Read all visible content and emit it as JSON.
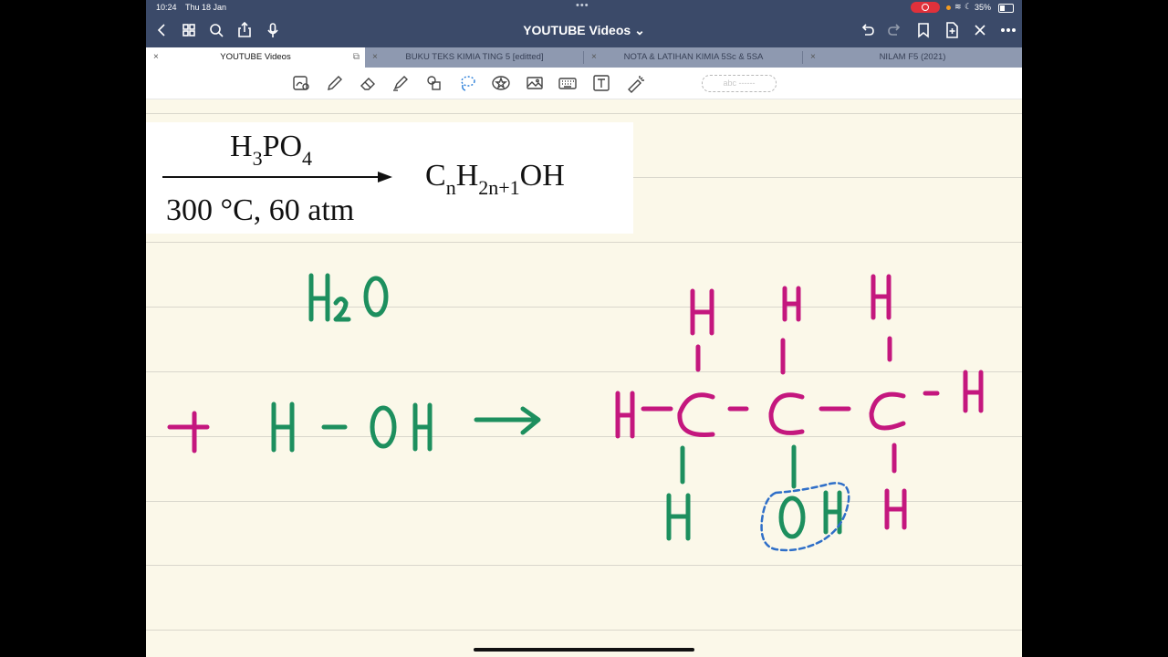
{
  "status_bar": {
    "time": "10:24",
    "date": "Thu 18 Jan",
    "battery": "35%"
  },
  "app": {
    "title": "YOUTUBE Videos"
  },
  "icons": {
    "back": "chevron-left-icon",
    "grid": "grid-icon",
    "search": "search-icon",
    "share": "share-icon",
    "mic": "microphone-icon",
    "undo": "undo-icon",
    "redo": "redo-icon",
    "bookmark": "bookmark-icon",
    "add_page": "add-page-icon",
    "close": "close-icon",
    "more": "more-icon"
  },
  "tabs": [
    {
      "label": "YOUTUBE Videos",
      "active": true
    },
    {
      "label": "BUKU TEKS KIMIA TING 5 [editted]",
      "active": false
    },
    {
      "label": "NOTA & LATIHAN KIMIA 5Sc & 5SA",
      "active": false
    },
    {
      "label": "NILAM F5 (2021)",
      "active": false
    }
  ],
  "toolbar": {
    "tools": [
      "reading-mode-icon",
      "pen-icon",
      "eraser-icon",
      "highlighter-icon",
      "shapes-icon",
      "lasso-icon",
      "sticker-icon",
      "image-icon",
      "keyboard-icon",
      "text-icon",
      "laser-pointer-icon"
    ],
    "textbox_placeholder": "abc ------"
  },
  "formula": {
    "reagent": {
      "base": "H",
      "sub1": "3",
      "mid": "PO",
      "sub2": "4"
    },
    "conditions": "300 °C, 60 atm",
    "product": {
      "c": "C",
      "sub_n": "n",
      "h": "H",
      "sub_h": "2n+1",
      "oh": "OH"
    }
  },
  "handwriting": {
    "water_formula": "H2O",
    "equation": "+ H – OH →",
    "structure": {
      "top_h": [
        "H",
        "H",
        "H"
      ],
      "middle": "H–C–C–C–H",
      "bottom": [
        "H",
        "OH",
        "H"
      ],
      "circled": "OH"
    }
  },
  "colors": {
    "ink_green": "#1d8f5e",
    "ink_magenta": "#c4177e",
    "ink_blue_dashed": "#2f6fc8",
    "header_bg": "#3b4a69",
    "paper": "#fbf8e9",
    "tab_bar": "#8e99b0"
  }
}
